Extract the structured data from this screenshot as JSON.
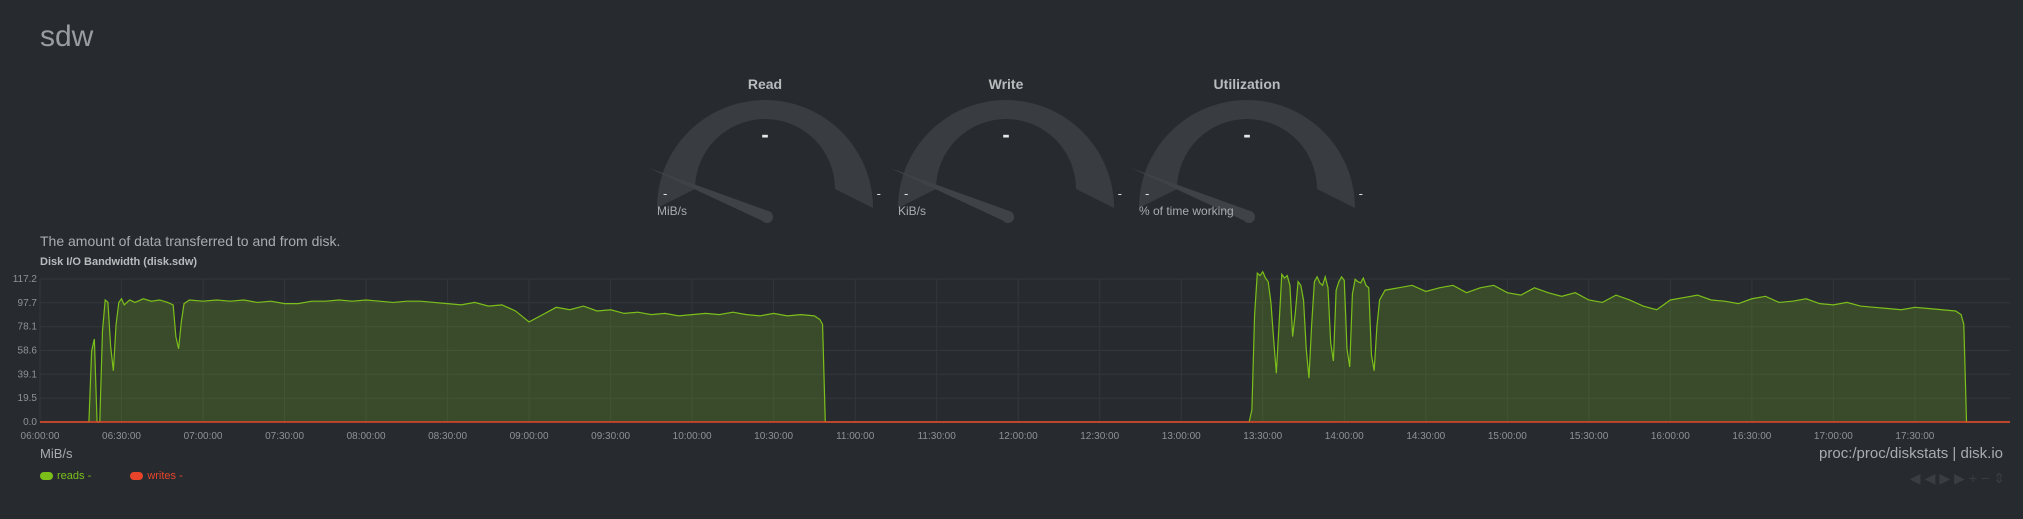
{
  "title": "sdw",
  "gauges": [
    {
      "title": "Read",
      "value": "-",
      "min": "-",
      "max": "-",
      "units": "MiB/s"
    },
    {
      "title": "Write",
      "value": "-",
      "min": "-",
      "max": "-",
      "units": "KiB/s"
    },
    {
      "title": "Utilization",
      "value": "-",
      "min": "-",
      "max": "-",
      "units": "% of time working"
    }
  ],
  "info": "The amount of data transferred to and from disk.",
  "chart_title": "Disk I/O Bandwidth (disk.sdw)",
  "units": "MiB/s",
  "source": "proc:/proc/diskstats | disk.io",
  "legend": [
    {
      "name": "reads",
      "value": "-",
      "color": "#7cbf1a"
    },
    {
      "name": "writes",
      "value": "-",
      "color": "#e8442a"
    }
  ],
  "colors": {
    "background": "#272b30",
    "reads": "#7cbf1a",
    "writes": "#e8442a",
    "gauge_bg": "#393c40"
  },
  "nav_icons": [
    "rewind-icon",
    "fast-forward-icon",
    "zoom-in-icon",
    "zoom-out-icon",
    "resize-icon"
  ],
  "chart_data": {
    "type": "area",
    "title": "Disk I/O Bandwidth (disk.sdw)",
    "ylabel": "MiB/s",
    "ylim": [
      0,
      117.2
    ],
    "y_ticks": [
      "0.0",
      "19.5",
      "39.1",
      "58.6",
      "78.1",
      "97.7",
      "117.2"
    ],
    "x_ticks": [
      "06:00:00",
      "06:30:00",
      "07:00:00",
      "07:30:00",
      "08:00:00",
      "08:30:00",
      "09:00:00",
      "09:30:00",
      "10:00:00",
      "10:30:00",
      "11:00:00",
      "11:30:00",
      "12:00:00",
      "12:30:00",
      "13:00:00",
      "13:30:00",
      "14:00:00",
      "14:30:00",
      "15:00:00",
      "15:30:00",
      "16:00:00",
      "16:30:00",
      "17:00:00",
      "17:30:00"
    ],
    "x_range": [
      "06:00:00",
      "18:05:00"
    ],
    "grid": true,
    "series": [
      {
        "name": "reads",
        "points": [
          [
            "06:00",
            0
          ],
          [
            "06:18",
            0
          ],
          [
            "06:19",
            58
          ],
          [
            "06:20",
            68
          ],
          [
            "06:21",
            0
          ],
          [
            "06:22",
            0
          ],
          [
            "06:23",
            75
          ],
          [
            "06:24",
            100
          ],
          [
            "06:25",
            98
          ],
          [
            "06:26",
            62
          ],
          [
            "06:27",
            42
          ],
          [
            "06:28",
            80
          ],
          [
            "06:29",
            98
          ],
          [
            "06:30",
            101
          ],
          [
            "06:31",
            96
          ],
          [
            "06:33",
            100
          ],
          [
            "06:35",
            98
          ],
          [
            "06:38",
            101
          ],
          [
            "06:41",
            99
          ],
          [
            "06:44",
            100
          ],
          [
            "06:47",
            98
          ],
          [
            "06:49",
            96
          ],
          [
            "06:50",
            70
          ],
          [
            "06:51",
            60
          ],
          [
            "06:52",
            82
          ],
          [
            "06:53",
            97
          ],
          [
            "06:55",
            100
          ],
          [
            "07:00",
            99
          ],
          [
            "07:05",
            100
          ],
          [
            "07:10",
            99
          ],
          [
            "07:15",
            100
          ],
          [
            "07:20",
            98
          ],
          [
            "07:25",
            99
          ],
          [
            "07:30",
            97
          ],
          [
            "07:35",
            97
          ],
          [
            "07:40",
            99
          ],
          [
            "07:45",
            99
          ],
          [
            "07:50",
            100
          ],
          [
            "07:55",
            99
          ],
          [
            "08:00",
            100
          ],
          [
            "08:05",
            99
          ],
          [
            "08:10",
            98
          ],
          [
            "08:15",
            99
          ],
          [
            "08:20",
            99
          ],
          [
            "08:25",
            98
          ],
          [
            "08:30",
            97
          ],
          [
            "08:35",
            96
          ],
          [
            "08:40",
            98
          ],
          [
            "08:45",
            95
          ],
          [
            "08:50",
            96
          ],
          [
            "08:55",
            91
          ],
          [
            "09:00",
            82
          ],
          [
            "09:05",
            88
          ],
          [
            "09:10",
            94
          ],
          [
            "09:15",
            92
          ],
          [
            "09:20",
            95
          ],
          [
            "09:25",
            91
          ],
          [
            "09:30",
            92
          ],
          [
            "09:35",
            89
          ],
          [
            "09:40",
            90
          ],
          [
            "09:45",
            88
          ],
          [
            "09:50",
            89
          ],
          [
            "09:55",
            87
          ],
          [
            "10:00",
            88
          ],
          [
            "10:05",
            89
          ],
          [
            "10:10",
            88
          ],
          [
            "10:15",
            90
          ],
          [
            "10:20",
            88
          ],
          [
            "10:25",
            87
          ],
          [
            "10:30",
            89
          ],
          [
            "10:35",
            87
          ],
          [
            "10:40",
            88
          ],
          [
            "10:45",
            87
          ],
          [
            "10:47",
            84
          ],
          [
            "10:48",
            80
          ],
          [
            "10:49",
            0
          ],
          [
            "13:25",
            0
          ],
          [
            "13:26",
            10
          ],
          [
            "13:27",
            88
          ],
          [
            "13:28",
            122
          ],
          [
            "13:29",
            120
          ],
          [
            "13:30",
            124
          ],
          [
            "13:31",
            118
          ],
          [
            "13:32",
            115
          ],
          [
            "13:33",
            98
          ],
          [
            "13:34",
            68
          ],
          [
            "13:35",
            40
          ],
          [
            "13:36",
            80
          ],
          [
            "13:37",
            121
          ],
          [
            "13:38",
            118
          ],
          [
            "13:39",
            120
          ],
          [
            "13:40",
            112
          ],
          [
            "13:41",
            70
          ],
          [
            "13:42",
            90
          ],
          [
            "13:43",
            115
          ],
          [
            "13:44",
            112
          ],
          [
            "13:45",
            100
          ],
          [
            "13:46",
            60
          ],
          [
            "13:47",
            36
          ],
          [
            "13:48",
            80
          ],
          [
            "13:49",
            115
          ],
          [
            "13:50",
            119
          ],
          [
            "13:51",
            114
          ],
          [
            "13:52",
            112
          ],
          [
            "13:53",
            119
          ],
          [
            "13:54",
            110
          ],
          [
            "13:55",
            65
          ],
          [
            "13:56",
            50
          ],
          [
            "13:57",
            108
          ],
          [
            "13:58",
            115
          ],
          [
            "13:59",
            119
          ],
          [
            "14:00",
            116
          ],
          [
            "14:01",
            60
          ],
          [
            "14:02",
            45
          ],
          [
            "14:03",
            105
          ],
          [
            "14:04",
            117
          ],
          [
            "14:05",
            115
          ],
          [
            "14:06",
            114
          ],
          [
            "14:07",
            118
          ],
          [
            "14:08",
            112
          ],
          [
            "14:09",
            110
          ],
          [
            "14:10",
            55
          ],
          [
            "14:11",
            42
          ],
          [
            "14:12",
            78
          ],
          [
            "14:13",
            100
          ],
          [
            "14:15",
            108
          ],
          [
            "14:20",
            110
          ],
          [
            "14:25",
            112
          ],
          [
            "14:30",
            107
          ],
          [
            "14:35",
            110
          ],
          [
            "14:40",
            112
          ],
          [
            "14:45",
            106
          ],
          [
            "14:50",
            110
          ],
          [
            "14:55",
            112
          ],
          [
            "15:00",
            106
          ],
          [
            "15:05",
            104
          ],
          [
            "15:10",
            110
          ],
          [
            "15:15",
            106
          ],
          [
            "15:20",
            103
          ],
          [
            "15:25",
            106
          ],
          [
            "15:30",
            100
          ],
          [
            "15:35",
            98
          ],
          [
            "15:40",
            104
          ],
          [
            "15:45",
            100
          ],
          [
            "15:50",
            95
          ],
          [
            "15:55",
            92
          ],
          [
            "16:00",
            100
          ],
          [
            "16:05",
            102
          ],
          [
            "16:10",
            104
          ],
          [
            "16:15",
            100
          ],
          [
            "16:20",
            99
          ],
          [
            "16:25",
            97
          ],
          [
            "16:30",
            101
          ],
          [
            "16:35",
            103
          ],
          [
            "16:40",
            98
          ],
          [
            "16:45",
            99
          ],
          [
            "16:50",
            101
          ],
          [
            "16:55",
            97
          ],
          [
            "17:00",
            96
          ],
          [
            "17:05",
            98
          ],
          [
            "17:10",
            95
          ],
          [
            "17:15",
            94
          ],
          [
            "17:20",
            93
          ],
          [
            "17:25",
            92
          ],
          [
            "17:30",
            94
          ],
          [
            "17:35",
            93
          ],
          [
            "17:40",
            92
          ],
          [
            "17:45",
            91
          ],
          [
            "17:47",
            88
          ],
          [
            "17:48",
            80
          ],
          [
            "17:49",
            0
          ],
          [
            "18:05",
            0
          ]
        ]
      },
      {
        "name": "writes",
        "points": [
          [
            "06:00",
            0
          ],
          [
            "18:05",
            0
          ]
        ]
      }
    ]
  }
}
